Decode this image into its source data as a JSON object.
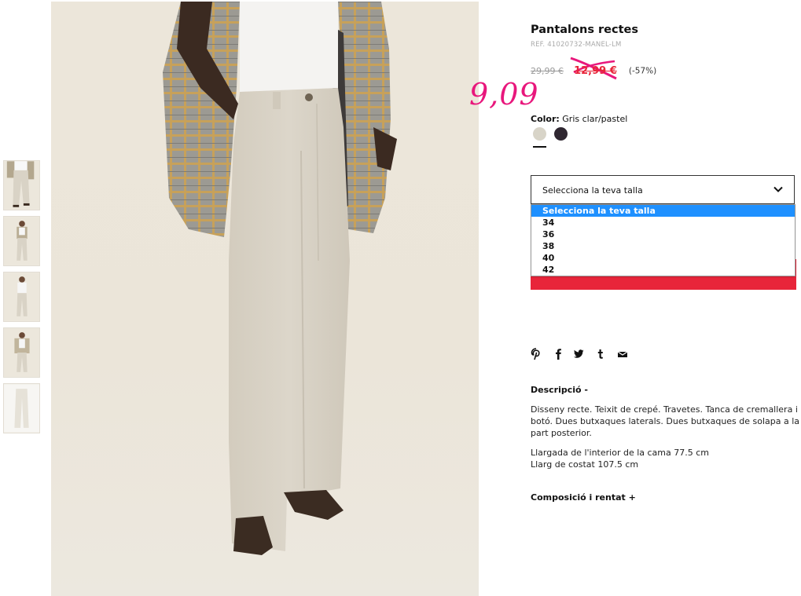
{
  "product": {
    "title": "Pantalons rectes",
    "ref": "REF. 41020732-MANEL-LM",
    "old_price": "29,99 €",
    "sale_price": "12,99 €",
    "discount": "(-57%)",
    "handwritten_price": "9,09",
    "color_label": "Color:",
    "color_value": "Gris clar/pastel",
    "swatches": [
      {
        "name": "Gris clar/pastel",
        "hex": "#d8d4c8",
        "selected": true
      },
      {
        "name": "dark",
        "hex": "#2f2731",
        "selected": false
      }
    ]
  },
  "size_select": {
    "label": "Selecciona la teva talla",
    "options": [
      "Selecciona la teva talla",
      "34",
      "36",
      "38",
      "40",
      "42"
    ],
    "selected_index": 0
  },
  "share_icons": [
    "pinterest-icon",
    "facebook-icon",
    "twitter-icon",
    "tumblr-icon",
    "email-icon"
  ],
  "description": {
    "heading": "Descripció  -",
    "text1": "Disseny recte. Teixit de crepé. Travetes. Tanca de cremallera i botó. Dues butxaques laterals. Dues butxaques de solapa a la part posterior.",
    "text2_line1": "Llargada de l'interior de la cama 77.5 cm",
    "text2_line2": "Llarg de costat 107.5 cm"
  },
  "composition": {
    "heading": "Composició i rentat  +"
  },
  "colors": {
    "accent_red": "#e8253a",
    "handwriting_pink": "#e8177c",
    "select_highlight": "#1e90ff"
  }
}
